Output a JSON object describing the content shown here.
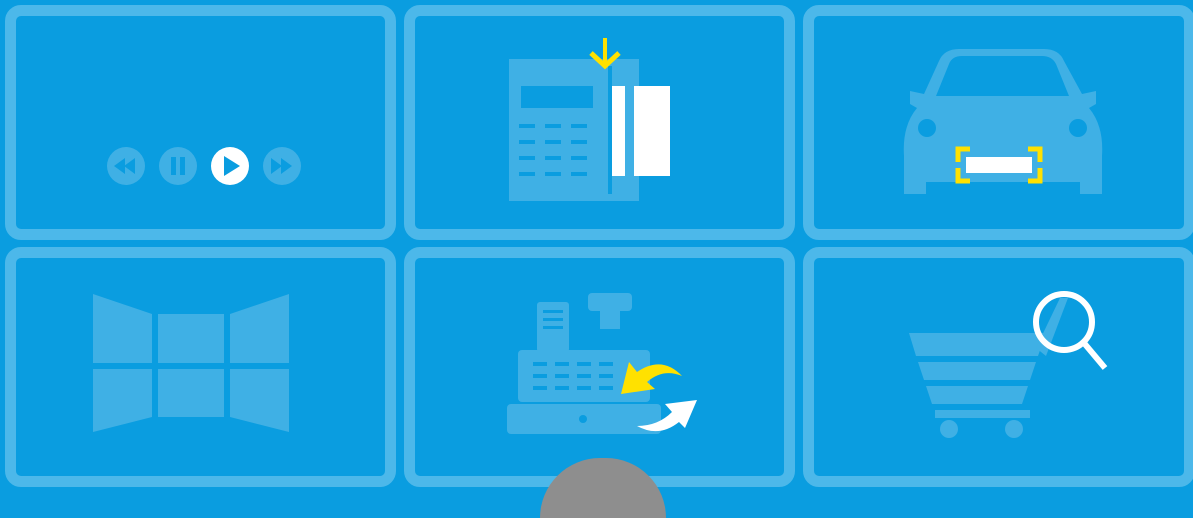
{
  "tiles": [
    {
      "icon": "media-controls-icon"
    },
    {
      "icon": "card-payment-terminal-icon"
    },
    {
      "icon": "car-license-plate-scan-icon"
    },
    {
      "icon": "windows-panorama-icon"
    },
    {
      "icon": "cash-register-exchange-icon"
    },
    {
      "icon": "shopping-cart-search-icon"
    }
  ],
  "colors": {
    "background": "#0a9de0",
    "tile_border": "#4cb8ea",
    "faded_icon": "#3fb0e5",
    "accent_yellow": "#ffe100",
    "white": "#ffffff",
    "peek_gray": "#8e8e8e"
  }
}
